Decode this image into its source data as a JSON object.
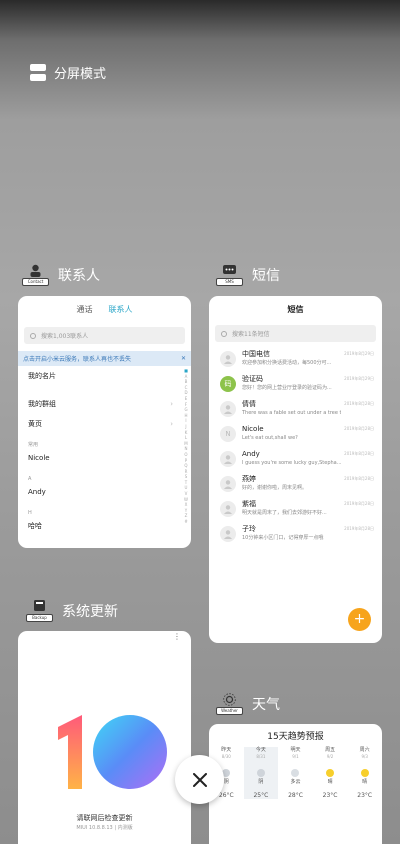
{
  "split_mode": {
    "label": "分屏模式",
    "icon": "split-screen-icon"
  },
  "contacts": {
    "title": "联系人",
    "icon_tag": "Contact",
    "tabs": [
      "通话",
      "联系人"
    ],
    "search_placeholder": "搜索1,003联系人",
    "banner": "点击开启小米云服务，联系人再也不丢失",
    "banner_close": "✕",
    "items": [
      {
        "kind": "row",
        "label": "我的名片"
      },
      {
        "kind": "gap"
      },
      {
        "kind": "row",
        "label": "我的群组",
        "chevron": "›"
      },
      {
        "kind": "row",
        "label": "黄页",
        "chevron": "›"
      },
      {
        "kind": "head",
        "label": "常用"
      },
      {
        "kind": "row",
        "label": "Nicole"
      },
      {
        "kind": "head",
        "label": "A"
      },
      {
        "kind": "row",
        "label": "Andy"
      },
      {
        "kind": "head",
        "label": "H"
      },
      {
        "kind": "row",
        "label": "哈哈"
      }
    ],
    "index_letters": [
      "■",
      "A",
      "B",
      "C",
      "D",
      "E",
      "F",
      "G",
      "H",
      "I",
      "J",
      "K",
      "L",
      "M",
      "N",
      "O",
      "P",
      "Q",
      "R",
      "S",
      "T",
      "U",
      "V",
      "W",
      "X",
      "Y",
      "Z",
      "#"
    ]
  },
  "sms": {
    "app_title": "短信",
    "icon_tag": "SMS",
    "title": "短信",
    "search_placeholder": "搜索11条短信",
    "messages": [
      {
        "avatar": "",
        "name": "中国电信",
        "preview": "欢迎参加积分换话费活动，每500分可...",
        "time": "2019年8月29日"
      },
      {
        "avatar": "码",
        "name": "验证码",
        "preview": "您好！您的网上营业厅登录的验证码为...",
        "time": "2019年8月29日",
        "green": true,
        "chevron": "›"
      },
      {
        "avatar": "",
        "name": "倩倩",
        "preview": "There was a fable set out under a tree t...",
        "time": "2019年8月28日"
      },
      {
        "avatar": "N",
        "name": "Nicole",
        "preview": "Let's eat out,shall we?",
        "time": "2019年8月28日"
      },
      {
        "avatar": "",
        "name": "Andy",
        "preview": "I guess you're some lucky guy,Stepha...",
        "time": "2019年8月28日"
      },
      {
        "avatar": "",
        "name": "燕婷",
        "preview": "好的，谢谢你啦，周末见啊。",
        "time": "2019年8月28日"
      },
      {
        "avatar": "",
        "name": "紫福",
        "preview": "明天就是周末了，我们去郊游好不好...",
        "time": "2019年8月28日"
      },
      {
        "avatar": "",
        "name": "子玲",
        "preview": "10分钟来小区门口，记得穿厚一点哦",
        "time": "2019年8月28日"
      }
    ],
    "fab": "+"
  },
  "update": {
    "title": "系统更新",
    "icon_tag": "Backup",
    "logo_text": "10",
    "message": "请联网后检查更新",
    "version": "MIUI 10.8.8.13 | 内测版",
    "menu": "⋮"
  },
  "weather": {
    "title": "天气",
    "icon_tag": "Weather",
    "card_title": "15天趋势预报",
    "days": [
      {
        "day": "昨天",
        "date": "8/30",
        "cond": "阴",
        "temp": "26°C",
        "icon_color": "#cfd4da"
      },
      {
        "day": "今天",
        "date": "8/31",
        "cond": "阴",
        "temp": "25°C",
        "icon_color": "#cfd4da",
        "selected": true
      },
      {
        "day": "明天",
        "date": "9/1",
        "cond": "多云",
        "temp": "28°C",
        "icon_color": "#d9dee3"
      },
      {
        "day": "周五",
        "date": "9/2",
        "cond": "晴",
        "temp": "23°C",
        "icon_color": "#f7cf2c"
      },
      {
        "day": "周六",
        "date": "9/3",
        "cond": "晴",
        "temp": "23°C",
        "icon_color": "#f7cf2c"
      }
    ]
  },
  "close_button": {
    "icon": "close-icon"
  },
  "colors": {
    "accent": "#2aa6c8",
    "fab": "#f7a41c",
    "verify_avatar": "#8dc34b"
  }
}
